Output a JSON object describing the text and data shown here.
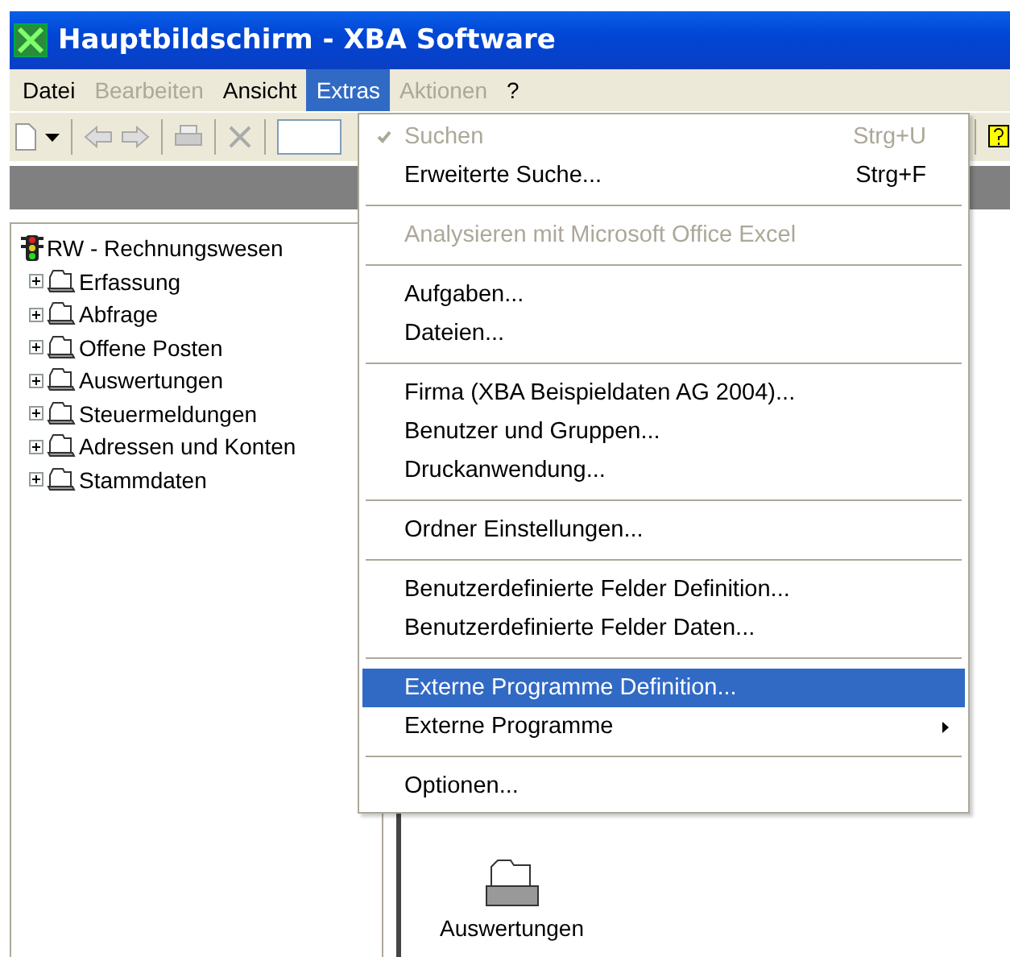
{
  "window": {
    "title": "Hauptbildschirm - XBA Software"
  },
  "menubar": [
    {
      "label": "Datei",
      "disabled": false,
      "selected": false
    },
    {
      "label": "Bearbeiten",
      "disabled": true,
      "selected": false
    },
    {
      "label": "Ansicht",
      "disabled": false,
      "selected": false
    },
    {
      "label": "Extras",
      "disabled": false,
      "selected": true
    },
    {
      "label": "Aktionen",
      "disabled": true,
      "selected": false
    },
    {
      "label": "?",
      "disabled": false,
      "selected": false
    }
  ],
  "tree": {
    "label": "RW - Rechnungswesen",
    "children": [
      {
        "label": "Erfassung",
        "expanded": false
      },
      {
        "label": "Abfrage",
        "expanded": false
      },
      {
        "label": "Offene Posten",
        "expanded": false
      },
      {
        "label": "Auswertungen",
        "expanded": false
      },
      {
        "label": "Steuermeldungen",
        "expanded": false
      },
      {
        "label": "Adressen und Konten",
        "expanded": false
      },
      {
        "label": "Stammdaten",
        "expanded": false
      }
    ]
  },
  "content": {
    "icon_label": "Auswertungen"
  },
  "menu": [
    {
      "kind": "item",
      "label": "Suchen",
      "shortcut": "Strg+U",
      "disabled": true,
      "checked": true,
      "selected": false
    },
    {
      "kind": "item",
      "label": "Erweiterte Suche...",
      "shortcut": "Strg+F",
      "disabled": false,
      "checked": false,
      "selected": false
    },
    {
      "kind": "separator"
    },
    {
      "kind": "item",
      "label": "Analysieren mit Microsoft Office Excel",
      "disabled": true,
      "checked": false,
      "selected": false
    },
    {
      "kind": "separator"
    },
    {
      "kind": "item",
      "label": "Aufgaben...",
      "disabled": false,
      "checked": false,
      "selected": false
    },
    {
      "kind": "item",
      "label": "Dateien...",
      "disabled": false,
      "checked": false,
      "selected": false
    },
    {
      "kind": "separator"
    },
    {
      "kind": "item",
      "label": "Firma (XBA Beispieldaten AG 2004)...",
      "disabled": false,
      "checked": false,
      "selected": false
    },
    {
      "kind": "item",
      "label": "Benutzer und Gruppen...",
      "disabled": false,
      "checked": false,
      "selected": false
    },
    {
      "kind": "item",
      "label": "Druckanwendung...",
      "disabled": false,
      "checked": false,
      "selected": false
    },
    {
      "kind": "separator"
    },
    {
      "kind": "item",
      "label": "Ordner Einstellungen...",
      "disabled": false,
      "checked": false,
      "selected": false
    },
    {
      "kind": "separator"
    },
    {
      "kind": "item",
      "label": "Benutzerdefinierte Felder Definition...",
      "disabled": false,
      "checked": false,
      "selected": false
    },
    {
      "kind": "item",
      "label": "Benutzerdefinierte Felder Daten...",
      "disabled": false,
      "checked": false,
      "selected": false
    },
    {
      "kind": "separator"
    },
    {
      "kind": "item",
      "label": "Externe Programme Definition...",
      "disabled": false,
      "checked": false,
      "selected": true
    },
    {
      "kind": "submenu",
      "label": "Externe Programme",
      "disabled": false,
      "checked": false,
      "selected": false
    },
    {
      "kind": "separator"
    },
    {
      "kind": "item",
      "label": "Optionen...",
      "disabled": false,
      "checked": false,
      "selected": false
    }
  ]
}
